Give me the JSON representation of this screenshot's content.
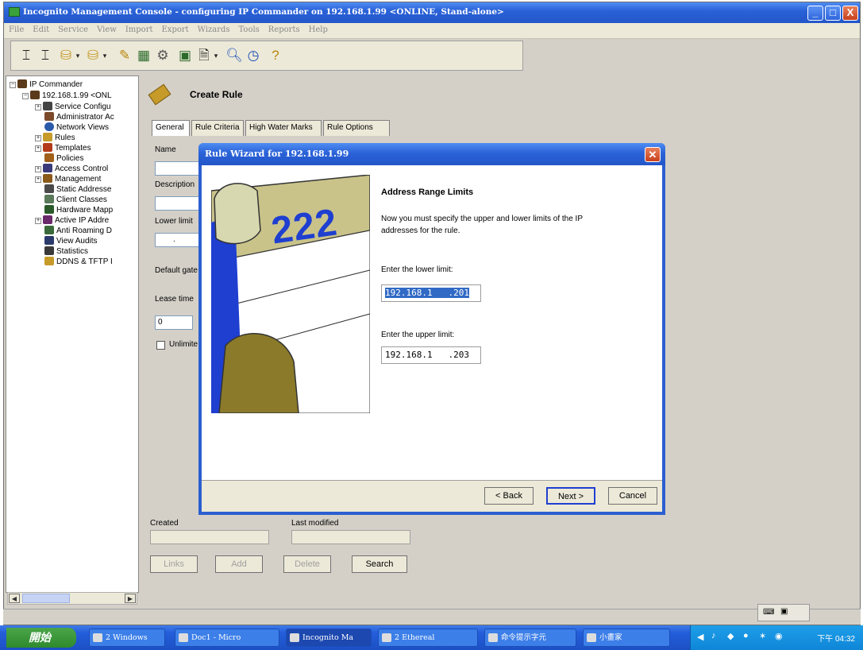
{
  "window": {
    "title": "Incognito Management Console - configuring IP Commander on 192.168.1.99 <ONLINE, Stand-alone>",
    "minimize": "_",
    "maximize": "□",
    "close": "X"
  },
  "menu": [
    "File",
    "Edit",
    "Service",
    "View",
    "Import",
    "Export",
    "Wizards",
    "Tools",
    "Reports",
    "Help"
  ],
  "tree": {
    "root": "IP Commander",
    "server": "192.168.1.99 <ONL",
    "items": [
      "Service Configu",
      "Administrator Ac",
      "Network Views",
      "Rules",
      "Templates",
      "Policies",
      "Access Control",
      "Management",
      "Static Addresse",
      "Client Classes",
      "Hardware Mapp",
      "Active IP Addre",
      "Anti Roaming D",
      "View Audits",
      "Statistics",
      "DDNS & TFTP I"
    ]
  },
  "panel": {
    "title": "Create Rule",
    "tabs": [
      "General",
      "Rule Criteria",
      "High Water Marks",
      "Rule Options"
    ],
    "name_label": "Name",
    "description_label": "Description",
    "lower_limit_label": "Lower limit",
    "lower_limit_value": ".",
    "default_gateway_label": "Default gate",
    "lease_time_label": "Lease time",
    "lease_time_value": "0",
    "unlimited_label": "Unlimite",
    "created_label": "Created",
    "last_modified_label": "Last modified",
    "buttons": {
      "links": "Links",
      "add": "Add",
      "delete": "Delete",
      "search": "Search"
    }
  },
  "dialog": {
    "title": "Rule Wizard for 192.168.1.99",
    "heading": "Address Range Limits",
    "description": "Now you must specify the upper and lower limits of the IP addresses for the rule.",
    "lower_label": "Enter the lower limit:",
    "lower_value": "192.168.1   .201",
    "upper_label": "Enter the upper limit:",
    "upper_value": "192.168.1   .203",
    "art_number": "222",
    "back": "< Back",
    "next": "Next >",
    "cancel": "Cancel"
  },
  "taskbar": {
    "start": "開始",
    "tasks": [
      "2 Windows",
      "Doc1 - Micro",
      "Incognito Ma",
      "2 Ethereal",
      "命令提示字元",
      "小畫家"
    ],
    "clock": "下午 04:32"
  }
}
